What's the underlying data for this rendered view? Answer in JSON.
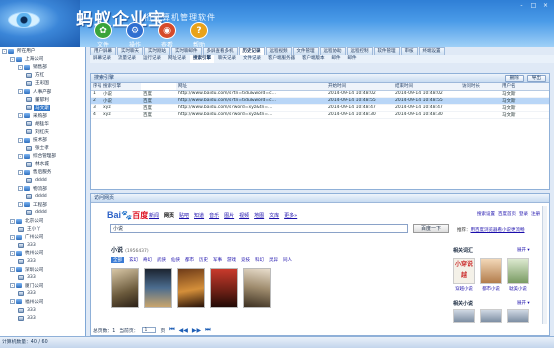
{
  "header": {
    "app_title": "蚂蚁企业宝",
    "app_subtitle": "桁计算机管理软件",
    "window_controls": [
      "-",
      "□",
      "×"
    ],
    "toolbar": [
      {
        "label": "文件",
        "icon": "file-icon",
        "color": "#3aa33a",
        "glyph": "✿"
      },
      {
        "label": "操作",
        "icon": "operate-icon",
        "color": "#2f6fd0",
        "glyph": "⚙"
      },
      {
        "label": "查看",
        "icon": "view-icon",
        "color": "#d64a2a",
        "glyph": "◉"
      },
      {
        "label": "帮助",
        "icon": "help-icon",
        "color": "#e8a21a",
        "glyph": "?"
      }
    ]
  },
  "sidebar": {
    "items": [
      {
        "label": "所在用户",
        "level": 0,
        "type": "group",
        "expander": "-"
      },
      {
        "label": "上海公司",
        "level": 1,
        "type": "group",
        "expander": "-"
      },
      {
        "label": "销售部",
        "level": 2,
        "type": "group",
        "expander": "-"
      },
      {
        "label": "方红",
        "level": 3,
        "type": "pc"
      },
      {
        "label": "王彩国",
        "level": 3,
        "type": "pc"
      },
      {
        "label": "人事产部",
        "level": 2,
        "type": "group",
        "expander": "-"
      },
      {
        "label": "董郁利",
        "level": 3,
        "type": "pc"
      },
      {
        "label": "马文斯",
        "level": 3,
        "type": "pc",
        "selected": true
      },
      {
        "label": "采购部",
        "level": 2,
        "type": "group",
        "expander": "-"
      },
      {
        "label": "胡猛华",
        "level": 3,
        "type": "pc"
      },
      {
        "label": "刘红庆",
        "level": 3,
        "type": "pc"
      },
      {
        "label": "技术部",
        "level": 2,
        "type": "group",
        "expander": "-"
      },
      {
        "label": "张士孝",
        "level": 3,
        "type": "pc"
      },
      {
        "label": "综合管理部",
        "level": 2,
        "type": "group",
        "expander": "-"
      },
      {
        "label": "林水城",
        "level": 3,
        "type": "pc"
      },
      {
        "label": "售后服务",
        "level": 2,
        "type": "group",
        "expander": "-"
      },
      {
        "label": "dddd",
        "level": 3,
        "type": "pc"
      },
      {
        "label": "物流部",
        "level": 2,
        "type": "group",
        "expander": "-"
      },
      {
        "label": "dddd",
        "level": 3,
        "type": "pc"
      },
      {
        "label": "工程部",
        "level": 2,
        "type": "group",
        "expander": "-"
      },
      {
        "label": "dddd",
        "level": 3,
        "type": "pc"
      },
      {
        "label": "北京公司",
        "level": 1,
        "type": "group",
        "expander": "-"
      },
      {
        "label": "王小丫",
        "level": 2,
        "type": "pc"
      },
      {
        "label": "广州公司",
        "level": 1,
        "type": "group",
        "expander": "-"
      },
      {
        "label": "333",
        "level": 2,
        "type": "pc"
      },
      {
        "label": "杭州公司",
        "level": 1,
        "type": "group",
        "expander": "-"
      },
      {
        "label": "333",
        "level": 2,
        "type": "pc"
      },
      {
        "label": "深圳公司",
        "level": 1,
        "type": "group",
        "expander": "-"
      },
      {
        "label": "333",
        "level": 2,
        "type": "pc"
      },
      {
        "label": "厦门公司",
        "level": 1,
        "type": "group",
        "expander": "-"
      },
      {
        "label": "333",
        "level": 2,
        "type": "pc"
      },
      {
        "label": "福州公司",
        "level": 1,
        "type": "group",
        "expander": "-"
      },
      {
        "label": "333",
        "level": 2,
        "type": "pc"
      },
      {
        "label": "333",
        "level": 2,
        "type": "pc"
      }
    ]
  },
  "tabs": [
    "用户屏幕",
    "实时聊天",
    "实时刚站",
    "实时聊邮件",
    "多屏查看多机",
    "历史记录",
    "远程视频",
    "文件管理",
    "远程协助",
    "远程控制",
    "软件管理",
    "审核",
    "终端设置"
  ],
  "tabs_active": 5,
  "subtabs": [
    "屏幕记录",
    "流量记录",
    "运行记录",
    "网址记录",
    "搜索引擎",
    "聊天记录",
    "文件记录",
    "客户端服务器",
    "客户端版本",
    "邮件",
    "邮件"
  ],
  "subtabs_active": 4,
  "records_panel": {
    "title": "搜索引擎",
    "buttons": [
      "删除",
      "导出"
    ],
    "columns": [
      "序号",
      "搜索引擎",
      "网址",
      "开始时间",
      "结束时间",
      "访问时长",
      "用户名"
    ],
    "rows": [
      [
        "1",
        "小说",
        "百度",
        "http://www.baidu.com/s?tn=tidu&word=c...",
        "2014-09-14 10:48:02",
        "2014-09-14 10:48:02",
        "",
        "马文斯"
      ],
      [
        "2",
        "小说",
        "百度",
        "http://www.baidu.com/s?tn=tidu&word=c...",
        "2014-09-14 10:48:55",
        "2014-09-14 10:48:55",
        "",
        "马文斯"
      ],
      [
        "3",
        "xyz",
        "百度",
        "http://www.baidu.com/s?word=xyz&tn=...",
        "2014-09-14 10:48:47",
        "2014-09-14 10:48:47",
        "",
        "马文斯"
      ],
      [
        "4",
        "xyz",
        "百度",
        "http://www.baidu.com/s?word=xyz&tn=...",
        "2014-09-14 10:48:30",
        "2014-09-14 10:48:30",
        "",
        "马文斯"
      ]
    ],
    "selected_row": 1
  },
  "browser_panel": {
    "title": "访问网页",
    "logo_main": "Bai",
    "logo_paw": "🐾",
    "logo_cn": "百度",
    "nav": [
      "新闻",
      "网页",
      "贴吧",
      "知道",
      "音乐",
      "图片",
      "视频",
      "地图",
      "文库",
      "更多»"
    ],
    "nav_active": 1,
    "top_links": [
      "搜索设置",
      "百度首页",
      "登录",
      "注册"
    ],
    "search_value": "小说",
    "search_button": "百度一下",
    "promo_prefix": "推荐：",
    "promo_link": "用百度浏览器看小说更流畅",
    "novel_heading": "小说",
    "novel_count": "(1956437)",
    "novel_cats": [
      "全部",
      "玄幻",
      "奇幻",
      "武侠",
      "仙侠",
      "都市",
      "历史",
      "军事",
      "游戏",
      "竞技",
      "科幻",
      "灵异",
      "同人"
    ],
    "novel_cats_active": 0,
    "related_title": "相关词汇",
    "related_more": "展开 ▾",
    "related_labels": [
      "穿越小说",
      "都市小说",
      "耽美小说"
    ],
    "related_cover_text": "小穿说越",
    "related2_title": "相关小说",
    "related2_more": "展开 ▾"
  },
  "pager": {
    "total_label": "总页数：1",
    "current_label": "当前页：",
    "current_value": "1",
    "suffix": "页"
  },
  "statusbar": {
    "text": "计算机数量：40 / 60"
  }
}
